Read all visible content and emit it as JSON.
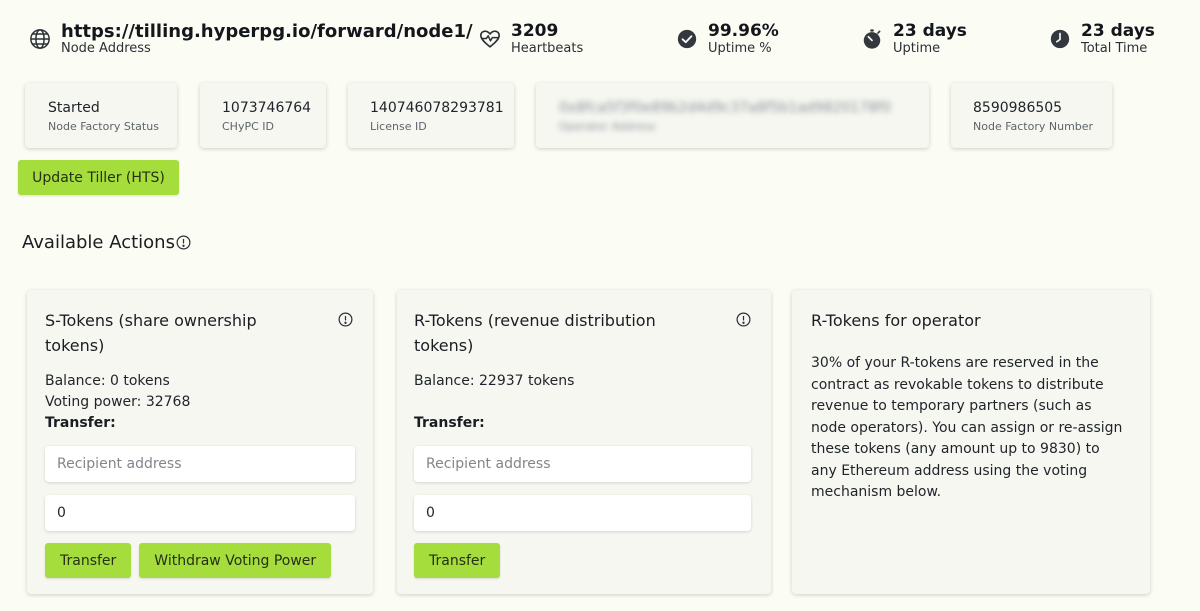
{
  "header": {
    "node_address": {
      "value": "https://tilling.hyperpg.io/forward/node1/",
      "label": "Node Address",
      "icon": "globe-icon"
    },
    "heartbeats": {
      "value": "3209",
      "label": "Heartbeats",
      "icon": "heartbeat-icon"
    },
    "uptime_pct": {
      "value": "99.96%",
      "label": "Uptime %",
      "icon": "check-circle-icon"
    },
    "uptime": {
      "value": "23 days",
      "label": "Uptime",
      "icon": "stopwatch-icon"
    },
    "total_time": {
      "value": "23 days",
      "label": "Total Time",
      "icon": "clock-icon"
    }
  },
  "cards": {
    "status": {
      "value": "Started",
      "label": "Node Factory Status"
    },
    "chypc": {
      "value": "1073746764",
      "label": "CHyPC ID"
    },
    "license": {
      "value": "140746078293781",
      "label": "License ID"
    },
    "operator": {
      "value": "0x8fca5f3f0e89b2d4d9c37a8f5b1ad9820178f0",
      "label": "Operator Address"
    },
    "factory_number": {
      "value": "8590986505",
      "label": "Node Factory Number"
    }
  },
  "update_button": "Update Tiller (HTS)",
  "actions": {
    "heading": "Available Actions",
    "s_tokens": {
      "title": "S-Tokens (share ownership tokens)",
      "balance": "Balance: 0 tokens",
      "voting_power": "Voting power: 32768",
      "transfer_label": "Transfer:",
      "recipient_placeholder": "Recipient address",
      "amount_value": "0",
      "transfer_button": "Transfer",
      "withdraw_button": "Withdraw Voting Power"
    },
    "r_tokens": {
      "title": "R-Tokens (revenue distribution tokens)",
      "balance": "Balance: 22937 tokens",
      "transfer_label": "Transfer:",
      "recipient_placeholder": "Recipient address",
      "amount_value": "0",
      "transfer_button": "Transfer"
    },
    "r_operator": {
      "title": "R-Tokens for operator",
      "text": "30% of your R-tokens are reserved in the contract as revokable tokens to distribute revenue to temporary partners (such as node operators). You can assign or re-assign these tokens (any amount up to 9830) to any Ethereum address using the voting mechanism below."
    }
  },
  "colors": {
    "background": "#fbfcf4",
    "card": "#f6f7f1",
    "accent_button": "#a5dd3d",
    "text": "#1a1e23"
  }
}
